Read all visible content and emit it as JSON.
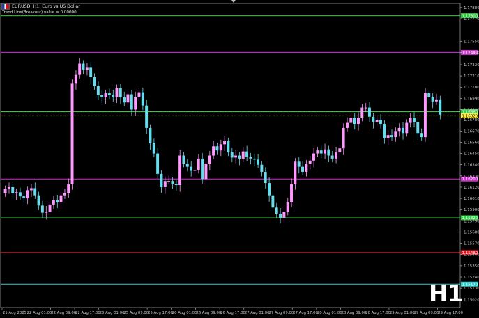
{
  "header": {
    "symbol": "EURUSD, H1:  Euro vs US Dollar",
    "indicator": "Trend Line(Breakout) value = 0.00000"
  },
  "watermark": "H1",
  "colors": {
    "background": "#000000",
    "axis": "#c8c8c8",
    "bull": "#ff99ff",
    "bear": "#66ddee",
    "green_level": "#2ecc40",
    "magenta_level": "#cc33cc",
    "red_level": "#e0101a",
    "cyan_level": "#33cccc",
    "bid_line": "#999944"
  },
  "chart_data": {
    "type": "candlestick",
    "ylim": [
      1.1494,
      1.1792
    ],
    "y_ticks": [
      "1.17880",
      "1.17770",
      "1.17550",
      "1.17440",
      "1.17320",
      "1.17210",
      "1.17100",
      "1.16990",
      "1.16880",
      "1.16780",
      "1.16670",
      "1.16560",
      "1.16450",
      "1.16340",
      "1.16230",
      "1.16120",
      "1.16010",
      "1.15900",
      "1.15790",
      "1.15680",
      "1.15570",
      "1.15460",
      "1.15350",
      "1.15240",
      "1.15130",
      "1.15020"
    ],
    "x_ticks": [
      "21 Aug 2025",
      "22 Aug 01:00",
      "22 Aug 09:00",
      "22 Aug 17:00",
      "25 Aug 01:00",
      "25 Aug 09:00",
      "25 Aug 17:00",
      "26 Aug 01:00",
      "26 Aug 09:00",
      "26 Aug 17:00",
      "27 Aug 01:00",
      "27 Aug 09:00",
      "27 Aug 17:00",
      "28 Aug 01:00",
      "28 Aug 09:00",
      "28 Aug 17:00",
      "29 Aug 01:00",
      "29 Aug 09:00",
      "29 Aug 17:00"
    ],
    "levels": [
      {
        "value": 1.178,
        "label": "1.17800",
        "color": "green_level"
      },
      {
        "value": 1.1744,
        "label": "1.17440",
        "color": "magenta_level"
      },
      {
        "value": 1.1686,
        "label": "1.16860",
        "color": "green_level"
      },
      {
        "value": 1.1682,
        "label": "1.16820",
        "color": "bid_line",
        "dashed": true,
        "badge": "#ffee44",
        "badge_text": "#000000"
      },
      {
        "value": 1.162,
        "label": "1.16200",
        "color": "magenta_level"
      },
      {
        "value": 1.1582,
        "label": "1.15820",
        "color": "green_level"
      },
      {
        "value": 1.1548,
        "label": "1.15480",
        "color": "red_level"
      },
      {
        "value": 1.1517,
        "label": "1.15170",
        "color": "cyan_level"
      }
    ],
    "close_path": [
      1.161,
      1.1612,
      1.1606,
      1.1607,
      1.1603,
      1.1601,
      1.1609,
      1.1611,
      1.1604,
      1.1594,
      1.1587,
      1.1588,
      1.1595,
      1.1599,
      1.1597,
      1.1604,
      1.1606,
      1.1615,
      1.1714,
      1.1722,
      1.1733,
      1.1727,
      1.1729,
      1.172,
      1.1711,
      1.1702,
      1.17,
      1.1704,
      1.1702,
      1.17,
      1.1709,
      1.17,
      1.1695,
      1.1703,
      1.1688,
      1.17,
      1.1705,
      1.1692,
      1.167,
      1.1655,
      1.1645,
      1.1625,
      1.1612,
      1.1618,
      1.1618,
      1.1615,
      1.1614,
      1.1643,
      1.1635,
      1.1632,
      1.1628,
      1.1629,
      1.164,
      1.162,
      1.1635,
      1.1643,
      1.1652,
      1.1648,
      1.1654,
      1.1657,
      1.1646,
      1.1641,
      1.1643,
      1.164,
      1.1647,
      1.1642,
      1.164,
      1.1639,
      1.1634,
      1.1627,
      1.1616,
      1.1604,
      1.1592,
      1.1586,
      1.1582,
      1.1588,
      1.1597,
      1.1615,
      1.1637,
      1.1632,
      1.1627,
      1.1635,
      1.1638,
      1.1645,
      1.1648,
      1.1645,
      1.1649,
      1.1643,
      1.164,
      1.1646,
      1.165,
      1.167,
      1.1675,
      1.168,
      1.1674,
      1.168,
      1.169,
      1.169,
      1.1681,
      1.1676,
      1.1678,
      1.1674,
      1.166,
      1.1663,
      1.1661,
      1.1667,
      1.167,
      1.1665,
      1.1675,
      1.168,
      1.1676,
      1.1665,
      1.1661,
      1.1704,
      1.17,
      1.1696,
      1.1698,
      1.1683
    ]
  }
}
